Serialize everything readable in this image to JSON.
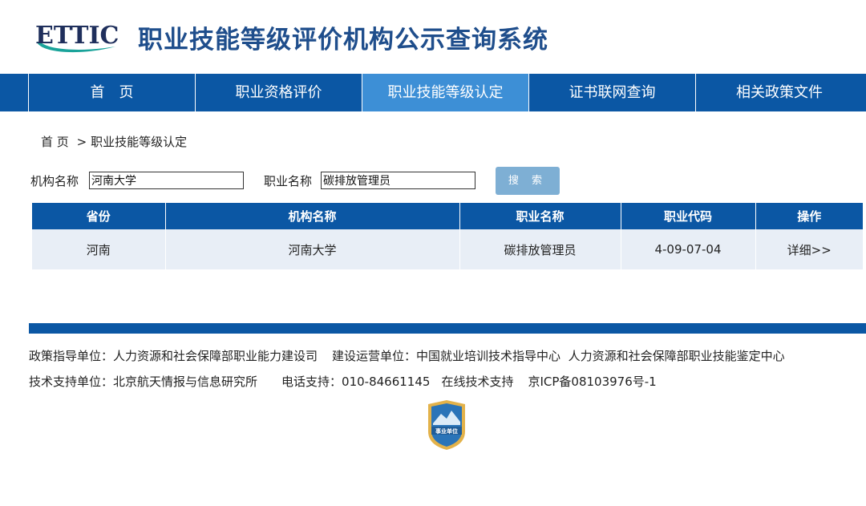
{
  "header": {
    "logo_text": "ETTIC",
    "title": "职业技能等级评价机构公示查询系统"
  },
  "nav": {
    "items": [
      {
        "label": "首　页"
      },
      {
        "label": "职业资格评价"
      },
      {
        "label": "职业技能等级认定"
      },
      {
        "label": "证书联网查询"
      },
      {
        "label": "相关政策文件"
      }
    ],
    "active_index": 2
  },
  "breadcrumb": {
    "home": "首 页",
    "separator": ">",
    "current": "职业技能等级认定"
  },
  "search": {
    "org_label": "机构名称",
    "org_value": "河南大学",
    "occupation_label": "职业名称",
    "occupation_value": "碳排放管理员",
    "button_label": "搜 索"
  },
  "table": {
    "headers": [
      "省份",
      "机构名称",
      "职业名称",
      "职业代码",
      "操作"
    ],
    "rows": [
      {
        "province": "河南",
        "org_name": "河南大学",
        "occupation": "碳排放管理员",
        "code": "4-09-07-04",
        "action": "详细>>"
      }
    ]
  },
  "footer": {
    "policy_label": "政策指导单位：",
    "policy_value": "人力资源和社会保障部职业能力建设司",
    "ops_label": "建设运营单位：",
    "ops_value": "中国就业培训技术指导中心  人力资源和社会保障部职业技能鉴定中心",
    "tech_label": "技术支持单位：",
    "tech_value": "北京航天情报与信息研究所",
    "phone_label": "电话支持：",
    "phone_value": "010-84661145",
    "online_support": "在线技术支持",
    "icp": "京ICP备08103976号-1",
    "badge_text": "事业单位"
  },
  "colors": {
    "primary": "#0b57a4",
    "nav_active": "#3d8fd6",
    "title": "#1f4e8c",
    "search_button": "#7eafd4",
    "row_bg": "#e8eef6",
    "logo_teal": "#1aa39a"
  }
}
